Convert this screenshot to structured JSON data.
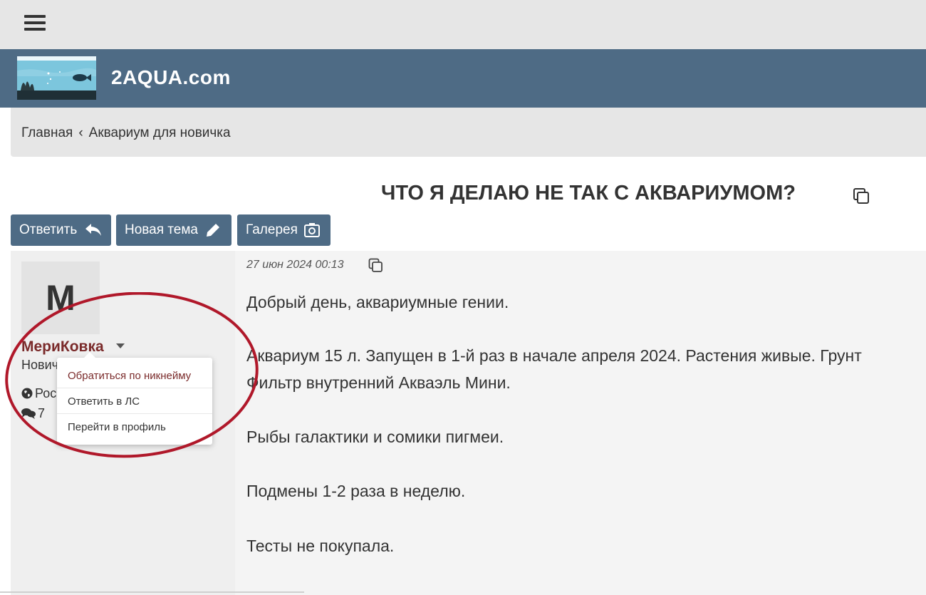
{
  "site": {
    "name": "2AQUA.com",
    "logo_icon": "aquarium-logo-icon",
    "colors": {
      "header": "#4e6b85",
      "accent": "#7a2a2a",
      "annotation": "#b0182a"
    }
  },
  "breadcrumb": {
    "home": "Главная",
    "separator": "‹",
    "current": "Аквариум для новичка"
  },
  "topic": {
    "title": "ЧТО Я ДЕЛАЮ НЕ ТАК С АКВАРИУМОМ?",
    "copy_icon": "copy-icon"
  },
  "toolbar": {
    "reply_label": "Ответить",
    "reply_icon": "reply-arrow-icon",
    "new_topic_label": "Новая тема",
    "new_topic_icon": "pencil-icon",
    "gallery_label": "Галерея",
    "gallery_icon": "camera-icon"
  },
  "post": {
    "author": {
      "avatar_letter": "М",
      "name": "МериКовка",
      "rank": "Новичок",
      "country": "Россия",
      "posts_count": "7"
    },
    "author_menu": {
      "items": [
        "Обратиться по никнейму",
        "Ответить в ЛС",
        "Перейти в профиль"
      ]
    },
    "date": "27 июн 2024 00:13",
    "body": [
      "Добрый день, аквариумные гении.",
      "Аквариум 15 л. Запущен в 1-й раз в начале апреля 2024. Растения живые. Грунт",
      "Фильтр внутренний Акваэль Мини.",
      "Рыбы галактики и сомики пигмеи.",
      "Подмены 1-2 раза в неделю.",
      "Тесты не покупала."
    ]
  }
}
